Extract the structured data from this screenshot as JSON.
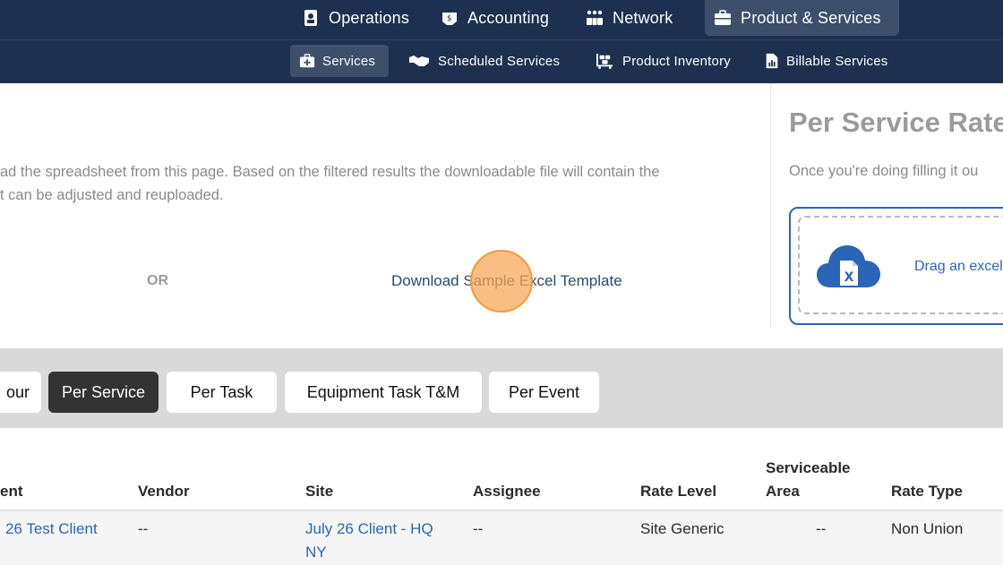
{
  "top_nav": {
    "items": [
      {
        "label": "Operations",
        "icon": "badge-icon"
      },
      {
        "label": "Accounting",
        "icon": "money-icon"
      },
      {
        "label": "Network",
        "icon": "network-icon"
      },
      {
        "label": "Product & Services",
        "icon": "briefcase-icon",
        "active": true
      }
    ]
  },
  "sub_nav": {
    "items": [
      {
        "label": "Services",
        "icon": "medical-kit-icon",
        "active": true
      },
      {
        "label": "Scheduled Services",
        "icon": "handshake-icon"
      },
      {
        "label": "Product Inventory",
        "icon": "dolly-icon"
      },
      {
        "label": "Billable Services",
        "icon": "report-icon"
      }
    ]
  },
  "upload": {
    "description_line1": "ad the spreadsheet from this page. Based on the filtered results the downloadable file will contain the",
    "description_line2": "t can be adjusted and reuploaded.",
    "or_label": "OR",
    "download_link": "Download Sample Excel Template"
  },
  "right_panel": {
    "title": "Per Service Rate",
    "description": "Once you're doing filling it ou",
    "drag_text": "Drag an excel f"
  },
  "rate_tabs": [
    {
      "label": "our"
    },
    {
      "label": "Per Service",
      "active": true
    },
    {
      "label": "Per Task"
    },
    {
      "label": "Equipment Task T&M"
    },
    {
      "label": "Per Event"
    }
  ],
  "table": {
    "headers": {
      "client": "ent",
      "vendor": "Vendor",
      "site": "Site",
      "assignee": "Assignee",
      "rate_level": "Rate Level",
      "serviceable_area_1": "Serviceable",
      "serviceable_area_2": "Area",
      "rate_type": "Rate Type"
    },
    "rows": [
      {
        "client": "26 Test Client",
        "vendor": "--",
        "site_1": "July 26 Client - HQ",
        "site_2": "NY",
        "assignee": "--",
        "rate_level": "Site Generic",
        "serviceable_area": "--",
        "rate_type": "Non Union"
      }
    ]
  },
  "colors": {
    "nav_bg": "#1e3050",
    "nav_active": "#3d4f6b",
    "accent_blue": "#2a65b7",
    "link_dark": "#2b4a6f",
    "click_indicator": "#f6a652"
  }
}
